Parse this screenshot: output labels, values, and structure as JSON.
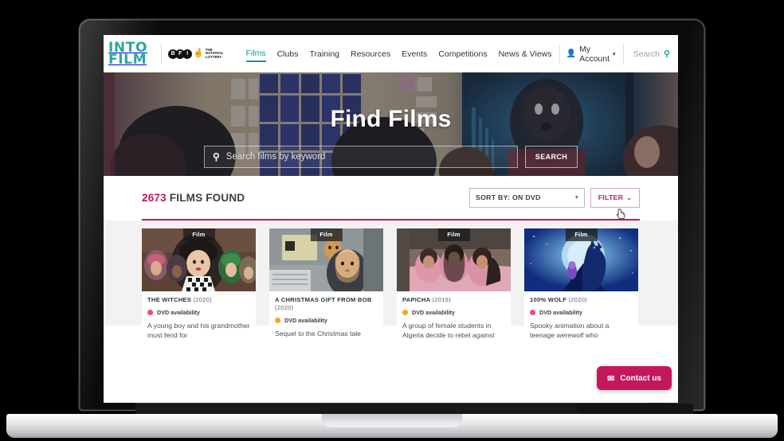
{
  "header": {
    "logo_line1": "INTO",
    "logo_line2": "FILM",
    "partner_bfi": "BFI",
    "partner_lottery_line1": "THE",
    "partner_lottery_line2": "NATIONAL",
    "partner_lottery_line3": "LOTTERY",
    "nav": [
      {
        "label": "Films",
        "active": true
      },
      {
        "label": "Clubs",
        "active": false
      },
      {
        "label": "Training",
        "active": false
      },
      {
        "label": "Resources",
        "active": false
      },
      {
        "label": "Events",
        "active": false
      },
      {
        "label": "Competitions",
        "active": false
      },
      {
        "label": "News & Views",
        "active": false
      }
    ],
    "account_label": "My Account",
    "account_caret": "▾",
    "search_label": "Search",
    "search_icon": "search-icon",
    "person_icon": "person-icon"
  },
  "hero": {
    "title": "Find Films",
    "search_placeholder": "Search films by keyword",
    "search_value": "",
    "search_button": "SEARCH",
    "magnifier_icon": "search-icon"
  },
  "results": {
    "count": "2673",
    "found_label": "FILMS FOUND",
    "sort_label": "SORT BY: ON DVD",
    "sort_caret": "▾",
    "filter_label": "FILTER",
    "filter_chev": "⌄",
    "cursor_icon": "hand-cursor-icon"
  },
  "cards": [
    {
      "badge": "Film",
      "title": "THE WITCHES",
      "year": "(2020)",
      "availability": "DVD availability",
      "availability_color": "#f04a6a",
      "description": "A young boy and his grandmother must fend for"
    },
    {
      "badge": "Film",
      "title": "A CHRISTMAS GIFT FROM BOB",
      "year": "(2020)",
      "availability": "DVD availability",
      "availability_color": "#f5a623",
      "description": "Sequel to the Christmas tale"
    },
    {
      "badge": "Film",
      "title": "PAPICHA",
      "year": "(2019)",
      "availability": "DVD availability",
      "availability_color": "#f5a623",
      "description": "A group of female students in Algeria decide to rebel against"
    },
    {
      "badge": "Film",
      "title": "100% WOLF",
      "year": "(2020)",
      "availability": "DVD availability",
      "availability_color": "#f04a6a",
      "description": "Spooky animation about a teenage werewolf who"
    }
  ],
  "contact": {
    "label": "Contact us",
    "icon": "envelope-icon"
  },
  "colors": {
    "brand_teal": "#2aa79b",
    "accent_crimson": "#c4175c",
    "page_bg": "#f2f2f2"
  }
}
